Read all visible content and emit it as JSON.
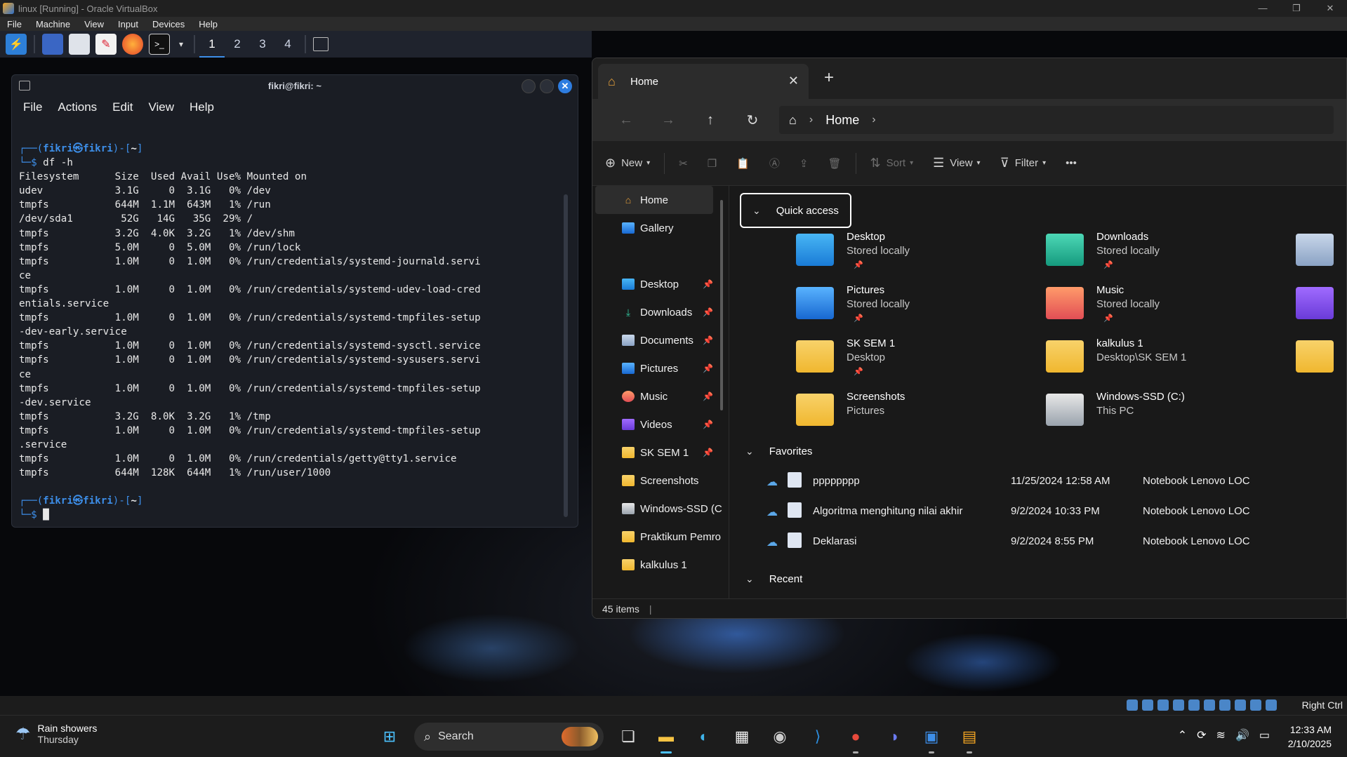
{
  "vbox": {
    "title": "linux [Running] - Oracle VirtualBox",
    "menu": [
      "File",
      "Machine",
      "View",
      "Input",
      "Devices",
      "Help"
    ],
    "host_key": "Right Ctrl",
    "controls": {
      "minimize": "—",
      "restore": "❐",
      "close": "✕"
    }
  },
  "kali_panel": {
    "workspaces": [
      "1",
      "2",
      "3",
      "4"
    ],
    "active_workspace": "1"
  },
  "terminal": {
    "title": "fikri@fikri: ~",
    "menu": [
      "File",
      "Actions",
      "Edit",
      "View",
      "Help"
    ],
    "prompt_user": "fikri㉿fikri",
    "prompt_dir": "~",
    "command": "df -h",
    "output_lines": [
      "Filesystem      Size  Used Avail Use% Mounted on",
      "udev            3.1G     0  3.1G   0% /dev",
      "tmpfs           644M  1.1M  643M   1% /run",
      "/dev/sda1        52G   14G   35G  29% /",
      "tmpfs           3.2G  4.0K  3.2G   1% /dev/shm",
      "tmpfs           5.0M     0  5.0M   0% /run/lock",
      "tmpfs           1.0M     0  1.0M   0% /run/credentials/systemd-journald.servi",
      "ce",
      "tmpfs           1.0M     0  1.0M   0% /run/credentials/systemd-udev-load-cred",
      "entials.service",
      "tmpfs           1.0M     0  1.0M   0% /run/credentials/systemd-tmpfiles-setup",
      "-dev-early.service",
      "tmpfs           1.0M     0  1.0M   0% /run/credentials/systemd-sysctl.service",
      "tmpfs           1.0M     0  1.0M   0% /run/credentials/systemd-sysusers.servi",
      "ce",
      "tmpfs           1.0M     0  1.0M   0% /run/credentials/systemd-tmpfiles-setup",
      "-dev.service",
      "tmpfs           3.2G  8.0K  3.2G   1% /tmp",
      "tmpfs           1.0M     0  1.0M   0% /run/credentials/systemd-tmpfiles-setup",
      ".service",
      "tmpfs           1.0M     0  1.0M   0% /run/credentials/getty@tty1.service",
      "tmpfs           644M  128K  644M   1% /run/user/1000"
    ]
  },
  "explorer": {
    "tab_title": "Home",
    "breadcrumb": "Home",
    "toolbar": {
      "new": "New",
      "sort": "Sort",
      "view": "View",
      "filter": "Filter",
      "more": "•••"
    },
    "sidebar": [
      {
        "label": "Home",
        "icon": "home-icon",
        "selected": true
      },
      {
        "label": "Gallery",
        "icon": "gallery-icon"
      },
      {
        "label": "Desktop",
        "icon": "desktop-icon",
        "pinned": true
      },
      {
        "label": "Downloads",
        "icon": "downloads-icon",
        "pinned": true
      },
      {
        "label": "Documents",
        "icon": "documents-icon",
        "pinned": true
      },
      {
        "label": "Pictures",
        "icon": "pictures-icon",
        "pinned": true
      },
      {
        "label": "Music",
        "icon": "music-icon",
        "pinned": true
      },
      {
        "label": "Videos",
        "icon": "videos-icon",
        "pinned": true
      },
      {
        "label": "SK SEM 1",
        "icon": "folder-icon",
        "pinned": true
      },
      {
        "label": "Screenshots",
        "icon": "folder-icon"
      },
      {
        "label": "Windows-SSD (C",
        "icon": "drive-icon"
      },
      {
        "label": "Praktikum Pemro",
        "icon": "folder-icon"
      },
      {
        "label": "kalkulus 1",
        "icon": "folder-icon"
      }
    ],
    "quick_access": {
      "header": "Quick access",
      "items": [
        {
          "name": "Desktop",
          "sub": "Stored locally"
        },
        {
          "name": "Downloads",
          "sub": "Stored locally"
        },
        {
          "name": "Pictures",
          "sub": "Stored locally"
        },
        {
          "name": "Music",
          "sub": "Stored locally"
        },
        {
          "name": "SK SEM 1",
          "sub": "Desktop"
        },
        {
          "name": "kalkulus 1",
          "sub": "Desktop\\SK SEM 1"
        },
        {
          "name": "Screenshots",
          "sub": "Pictures"
        },
        {
          "name": "Windows-SSD (C:)",
          "sub": "This PC"
        }
      ]
    },
    "favorites": {
      "header": "Favorites",
      "items": [
        {
          "name": "pppppppp",
          "date": "11/25/2024 12:58 AM",
          "location": "Notebook Lenovo LOC"
        },
        {
          "name": "Algoritma menghitung nilai akhir",
          "date": "9/2/2024 10:33 PM",
          "location": "Notebook Lenovo LOC"
        },
        {
          "name": "Deklarasi",
          "date": "9/2/2024 8:55 PM",
          "location": "Notebook Lenovo LOC"
        }
      ]
    },
    "recent_header": "Recent",
    "status": "45 items"
  },
  "taskbar": {
    "weather_title": "Rain showers",
    "weather_day": "Thursday",
    "search_label": "Search",
    "time": "12:33 AM",
    "date": "2/10/2025"
  }
}
